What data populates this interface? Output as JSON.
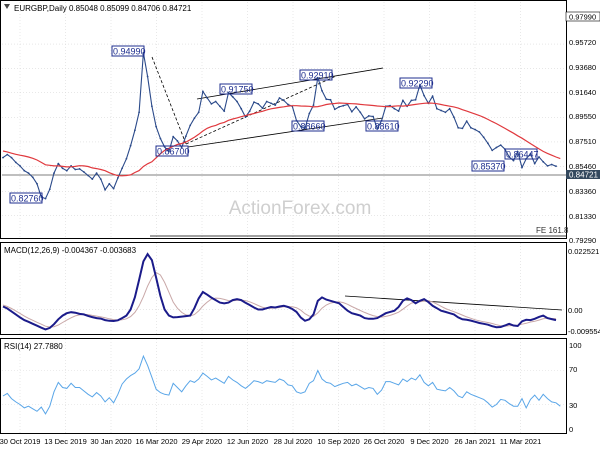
{
  "header": {
    "symbol_text": "EURGBP,Daily  0.85048 0.85099 0.84706 0.84721"
  },
  "watermark": "ActionForex.com",
  "colors": {
    "price": "#2b4a8a",
    "ma": "#e0393e",
    "label": "#1f2f8f",
    "grid": "#d9d9d9",
    "line": "#000000",
    "rsi": "#5aa6e8",
    "signal": "#c9a8a8",
    "macd": "#1b1b8a",
    "lastbox": "#34495e"
  },
  "chart_data": [
    {
      "type": "line",
      "title": "EURGBP,Daily",
      "ylim": [
        0.7929,
        0.9799
      ],
      "y_ticks": [
        "0.97990",
        "0.95720",
        "0.93680",
        "0.91640",
        "0.89550",
        "0.87510",
        "0.85460",
        "0.83360",
        "0.81330",
        "0.79290"
      ],
      "x_ticks": [
        "30 Oct 2019",
        "13 Dec 2019",
        "30 Jan 2020",
        "16 Mar 2020",
        "29 Apr 2020",
        "12 Jun 2020",
        "28 Jul 2020",
        "10 Sep 2020",
        "26 Oct 2020",
        "9 Dec 2020",
        "26 Jan 2021",
        "11 Mar 2021"
      ],
      "series": [
        {
          "name": "",
          "values": [
            0.862,
            0.8645,
            0.862,
            0.858,
            0.855,
            0.851,
            0.849,
            0.8455,
            0.84,
            0.829,
            0.8276,
            0.8355,
            0.849,
            0.857,
            0.853,
            0.851,
            0.855,
            0.852,
            0.8525,
            0.85,
            0.847,
            0.844,
            0.849,
            0.844,
            0.835,
            0.84,
            0.836,
            0.845,
            0.853,
            0.861,
            0.872,
            0.885,
            0.9,
            0.9499,
            0.93,
            0.905,
            0.888,
            0.878,
            0.871,
            0.867,
            0.8795,
            0.876,
            0.8705,
            0.88,
            0.889,
            0.895,
            0.9,
            0.9175,
            0.912,
            0.907,
            0.909,
            0.905,
            0.901,
            0.9165,
            0.913,
            0.909,
            0.903,
            0.896,
            0.901,
            0.9085,
            0.907,
            0.9035,
            0.909,
            0.9075,
            0.906,
            0.912,
            0.91,
            0.9065,
            0.905,
            0.893,
            0.888,
            0.8866,
            0.899,
            0.906,
            0.9291,
            0.918,
            0.911,
            0.9105,
            0.9025,
            0.9045,
            0.9055,
            0.9065,
            0.9005,
            0.9045,
            0.9,
            0.8945,
            0.897,
            0.8965,
            0.8861,
            0.893,
            0.905,
            0.9055,
            0.903,
            0.901,
            0.91,
            0.905,
            0.91,
            0.9105,
            0.9229,
            0.914,
            0.9075,
            0.9135,
            0.903,
            0.9015,
            0.9,
            0.903,
            0.896,
            0.887,
            0.8865,
            0.8925,
            0.887,
            0.8855,
            0.8835,
            0.879,
            0.874,
            0.868,
            0.8705,
            0.8725,
            0.869,
            0.8625,
            0.8595,
            0.867,
            0.8537,
            0.861,
            0.8651,
            0.857,
            0.8625,
            0.8585,
            0.855,
            0.8562,
            0.8548
          ]
        },
        {
          "name": "",
          "values": [
            0.8675,
            0.8668,
            0.8657,
            0.8648,
            0.864,
            0.8633,
            0.8625,
            0.8614,
            0.86,
            0.858,
            0.856,
            0.8555,
            0.855,
            0.855,
            0.8546,
            0.8542,
            0.8543,
            0.8546,
            0.8552,
            0.855,
            0.8545,
            0.8534,
            0.8528,
            0.852,
            0.851,
            0.8493,
            0.848,
            0.8468,
            0.8467,
            0.847,
            0.8475,
            0.8495,
            0.8511,
            0.8545,
            0.8568,
            0.8585,
            0.8618,
            0.8652,
            0.868,
            0.8698,
            0.8715,
            0.873,
            0.8738,
            0.875,
            0.877,
            0.879,
            0.8815,
            0.8843,
            0.8866,
            0.888,
            0.889,
            0.8905,
            0.8915,
            0.8933,
            0.8944,
            0.8953,
            0.8963,
            0.8972,
            0.8981,
            0.899,
            0.9,
            0.9008,
            0.902,
            0.9029,
            0.9035,
            0.9041,
            0.9046,
            0.9052,
            0.9055,
            0.9055,
            0.9053,
            0.9052,
            0.905,
            0.9045,
            0.9048,
            0.9055,
            0.9065,
            0.907,
            0.9074,
            0.9078,
            0.9076,
            0.9074,
            0.9072,
            0.907,
            0.9066,
            0.9063,
            0.906,
            0.9057,
            0.9053,
            0.905,
            0.9048,
            0.9048,
            0.9052,
            0.9054,
            0.9052,
            0.9056,
            0.9061,
            0.9066,
            0.9071,
            0.9075,
            0.9078,
            0.9076,
            0.9072,
            0.9065,
            0.9058,
            0.9051,
            0.9045,
            0.9035,
            0.9022,
            0.901,
            0.8997,
            0.8985,
            0.8973,
            0.8958,
            0.894,
            0.8922,
            0.8905,
            0.8885,
            0.8865,
            0.8845,
            0.8825,
            0.8803,
            0.8783,
            0.876,
            0.8737,
            0.8715,
            0.8693,
            0.8672,
            0.8655,
            0.864,
            0.8625,
            0.8612
          ]
        }
      ],
      "annotations": [
        "0.94990",
        "0.91750",
        "0.92910",
        "0.92290",
        "0.88660",
        "0.88610",
        "0.86700",
        "0.82760",
        "0.85370",
        "0.86447",
        "FE 161.8"
      ],
      "last_price": "0.84721",
      "grid": true
    },
    {
      "type": "line",
      "title": "MACD(12,26,9) -0.004367 -0.003683",
      "ylim": [
        -0.009554,
        0.022521
      ],
      "y_ticks": [
        "0.022521",
        "0.00",
        "-0.009554"
      ],
      "series": [
        {
          "name": "",
          "values": [
            0.0012,
            0.0004,
            -0.0008,
            -0.002,
            -0.0032,
            -0.0043,
            -0.005,
            -0.0058,
            -0.0066,
            -0.0074,
            -0.0081,
            -0.0075,
            -0.006,
            -0.004,
            -0.0025,
            -0.0015,
            -0.0011,
            -0.0013,
            -0.0018,
            -0.002,
            -0.0026,
            -0.0031,
            -0.0035,
            -0.0037,
            -0.0043,
            -0.0046,
            -0.0047,
            -0.0044,
            -0.0035,
            -0.0025,
            0.0,
            0.005,
            0.012,
            0.0195,
            0.0225,
            0.02,
            0.013,
            0.0055,
            0.0,
            -0.0025,
            -0.0032,
            -0.0031,
            -0.0029,
            -0.0027,
            -0.0025,
            0.0005,
            0.0045,
            0.0071,
            0.006,
            0.0048,
            0.0038,
            0.0028,
            0.0025,
            0.0028,
            0.0038,
            0.0042,
            0.0038,
            0.0027,
            0.0018,
            0.0008,
            0.0,
            0.0,
            0.0005,
            0.001,
            0.0008,
            0.0012,
            0.0015,
            0.001,
            0.0002,
            -0.001,
            -0.0033,
            -0.0046,
            -0.004,
            -0.002,
            0.0035,
            0.0049,
            0.004,
            0.0035,
            0.003,
            0.0025,
            0.001,
            -0.0005,
            -0.0015,
            -0.002,
            -0.0025,
            -0.0035,
            -0.0038,
            -0.0038,
            -0.0035,
            -0.0025,
            -0.0015,
            -0.001,
            -0.0005,
            0.001,
            0.0035,
            0.0045,
            0.0038,
            0.0025,
            0.0035,
            0.0042,
            0.003,
            0.0015,
            0.0005,
            -0.0005,
            -0.001,
            -0.0015,
            -0.002,
            -0.0032,
            -0.004,
            -0.0042,
            -0.0045,
            -0.005,
            -0.0055,
            -0.0058,
            -0.0062,
            -0.0068,
            -0.0072,
            -0.0071,
            -0.0065,
            -0.0058,
            -0.0065,
            -0.0067,
            -0.0048,
            -0.0042,
            -0.0043,
            -0.0038,
            -0.003,
            -0.0025,
            -0.0035,
            -0.0039,
            -0.0043
          ]
        },
        {
          "name": "",
          "values": [
            0.0018,
            0.0012,
            0.0004,
            -0.0006,
            -0.0016,
            -0.0027,
            -0.0036,
            -0.0044,
            -0.0052,
            -0.006,
            -0.0068,
            -0.0071,
            -0.007,
            -0.0063,
            -0.0053,
            -0.0043,
            -0.0034,
            -0.0026,
            -0.0022,
            -0.002,
            -0.0021,
            -0.0024,
            -0.0027,
            -0.003,
            -0.0034,
            -0.0038,
            -0.0041,
            -0.0043,
            -0.0042,
            -0.0038,
            -0.0029,
            -0.0012,
            0.0015,
            0.0052,
            0.0095,
            0.013,
            0.015,
            0.014,
            0.011,
            0.007,
            0.003,
            0.0005,
            -0.0012,
            -0.0022,
            -0.0026,
            -0.0021,
            -0.0006,
            0.0014,
            0.003,
            0.0042,
            0.0046,
            0.0045,
            0.0041,
            0.0036,
            0.0035,
            0.0037,
            0.0038,
            0.0036,
            0.0031,
            0.0024,
            0.0016,
            0.0009,
            0.0005,
            0.0005,
            0.0006,
            0.0008,
            0.0011,
            0.0012,
            0.0011,
            0.0007,
            -0.0003,
            -0.0017,
            -0.0027,
            -0.0028,
            -0.0014,
            0.0005,
            0.0018,
            0.0026,
            0.003,
            0.0031,
            0.0028,
            0.0021,
            0.0012,
            0.0004,
            -0.0004,
            -0.0012,
            -0.0019,
            -0.0025,
            -0.0029,
            -0.0031,
            -0.0028,
            -0.0024,
            -0.0018,
            -0.0011,
            0.0001,
            0.0014,
            0.0026,
            0.003,
            0.0031,
            0.0034,
            0.0036,
            0.003,
            0.0022,
            0.0013,
            0.0004,
            -0.0003,
            -0.0009,
            -0.0016,
            -0.0023,
            -0.003,
            -0.0036,
            -0.0042,
            -0.0046,
            -0.005,
            -0.0053,
            -0.0057,
            -0.0062,
            -0.0066,
            -0.0068,
            -0.0066,
            -0.0065,
            -0.0064,
            -0.006,
            -0.0056,
            -0.0051,
            -0.0048,
            -0.0043,
            -0.0038,
            -0.0036,
            -0.0037,
            -0.0037
          ]
        }
      ]
    },
    {
      "type": "line",
      "title": "RSI(14) 27.7880",
      "ylim": [
        0,
        100
      ],
      "y_ticks": [
        "100",
        "70",
        "30",
        "0"
      ],
      "series": [
        {
          "name": "",
          "values": [
            40,
            43,
            37,
            33,
            30,
            26,
            28,
            25,
            22,
            27,
            19,
            28,
            45,
            56,
            50,
            49,
            55,
            50,
            50,
            46,
            42,
            39,
            44,
            40,
            33,
            38,
            32,
            42,
            54,
            60,
            64,
            67,
            72,
            87,
            76,
            62,
            48,
            44,
            42,
            41,
            55,
            50,
            45,
            52,
            58,
            56,
            60,
            67,
            63,
            59,
            61,
            58,
            55,
            63,
            59,
            56,
            52,
            49,
            53,
            58,
            57,
            55,
            58,
            57,
            56,
            60,
            58,
            53,
            52,
            45,
            43,
            45,
            55,
            58,
            70,
            60,
            56,
            55,
            51,
            53,
            55,
            56,
            52,
            54,
            51,
            48,
            50,
            49,
            42,
            47,
            57,
            57,
            55,
            53,
            60,
            57,
            61,
            59,
            65,
            56,
            52,
            56,
            48,
            47,
            46,
            50,
            46,
            40,
            38,
            45,
            42,
            40,
            38,
            36,
            32,
            27,
            30,
            36,
            35,
            31,
            28,
            28,
            37,
            26,
            36,
            41,
            35,
            42,
            37,
            33,
            32,
            28
          ]
        }
      ]
    }
  ]
}
